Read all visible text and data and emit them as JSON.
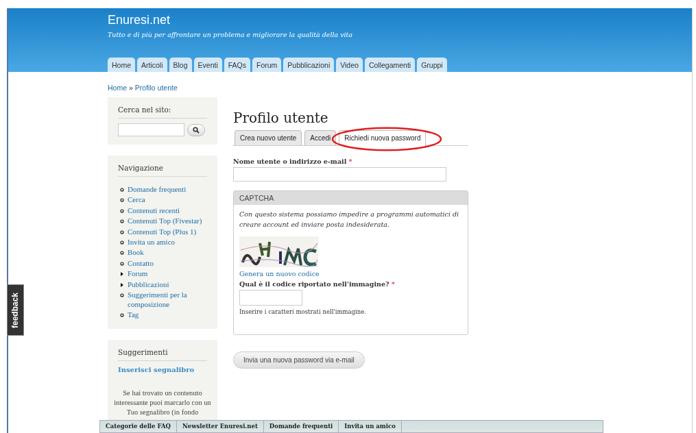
{
  "site": {
    "title": "Enuresi.net",
    "tagline": "Tutto e di più per affrontare un problema e migliorare la qualità della vita"
  },
  "primary_tabs": [
    "Home",
    "Articoli",
    "Blog",
    "Eventi",
    "FAQs",
    "Forum",
    "Pubblicazioni",
    "Video",
    "Collegamenti",
    "Gruppi"
  ],
  "breadcrumb": [
    {
      "label": "Home"
    },
    {
      "label": "Profilo utente"
    }
  ],
  "breadcrumb_separator": "»",
  "search_block": {
    "title": "Cerca nel sito:"
  },
  "navigation": {
    "title": "Navigazione",
    "items": [
      {
        "label": "Domande frequenti",
        "expandable": false
      },
      {
        "label": "Cerca",
        "expandable": false
      },
      {
        "label": "Contenuti recenti",
        "expandable": false
      },
      {
        "label": "Contenuti Top (Fivestar)",
        "expandable": false
      },
      {
        "label": "Contenuti Top (Plus 1)",
        "expandable": false
      },
      {
        "label": "Invita un amico",
        "expandable": false
      },
      {
        "label": "Book",
        "expandable": false
      },
      {
        "label": "Contatto",
        "expandable": false
      },
      {
        "label": "Forum",
        "expandable": true
      },
      {
        "label": "Pubblicazioni",
        "expandable": true
      },
      {
        "label": "Suggerimenti per la composizione",
        "expandable": false
      },
      {
        "label": "Tag",
        "expandable": false
      }
    ]
  },
  "suggestions": {
    "title": "Suggerimenti",
    "link": "Inserisci segnalibro",
    "text": "Se hai trovato un contenuto interessante puoi marcarlo con un Tuo segnalibro (in fondo"
  },
  "page_title": "Profilo utente",
  "tabs": [
    {
      "label": "Crea nuovo utente",
      "selected": false
    },
    {
      "label": "Accedi",
      "selected": false
    },
    {
      "label": "Richiedi nuova password",
      "selected": true
    }
  ],
  "username_field": {
    "label": "Nome utente o indirizzo e-mail",
    "required_mark": "*"
  },
  "captcha": {
    "legend": "CAPTCHA",
    "description": "Con questo sistema possiamo impedire a programmi automatici di creare account ed inviare posta indesiderata.",
    "new_code_link": "Genera un nuovo codice",
    "field_label": "Qual è il codice riportato nell'immagine?",
    "required_mark": "*",
    "help": "Inserire i caratteri mostrati nell'immagine."
  },
  "submit_button": "Invia una nuova password via e-mail",
  "feedback_tab": "feedback",
  "bottom_bar": [
    "Categorie delle FAQ",
    "Newsletter Enuresi.net",
    "Domande frequenti",
    "Invita un amico"
  ]
}
